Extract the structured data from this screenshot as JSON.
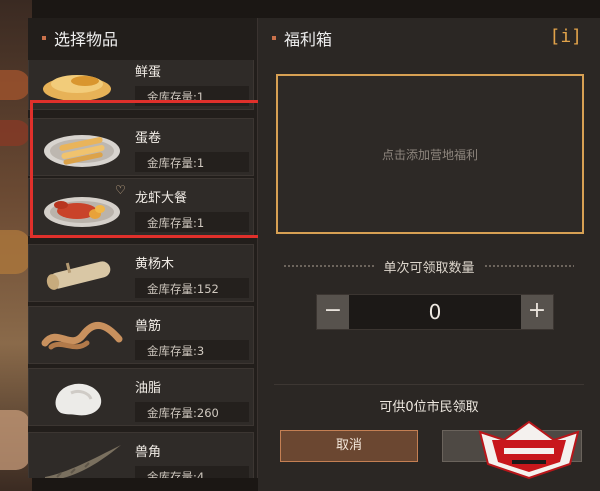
{
  "left_panel": {
    "title": "选择物品",
    "items": [
      {
        "name": "鲜蛋",
        "stock": "金库存量:1",
        "icon": "egg-dish-icon"
      },
      {
        "name": "蛋卷",
        "stock": "金库存量:1",
        "icon": "egg-roll-icon"
      },
      {
        "name": "龙虾大餐",
        "stock": "金库存量:1",
        "icon": "lobster-meal-icon",
        "favorite": "♡"
      },
      {
        "name": "黄杨木",
        "stock": "金库存量:152",
        "icon": "wood-log-icon"
      },
      {
        "name": "兽筋",
        "stock": "金库存量:3",
        "icon": "tendon-icon"
      },
      {
        "name": "油脂",
        "stock": "金库存量:260",
        "icon": "fat-icon"
      },
      {
        "name": "兽角",
        "stock": "金库存量:4",
        "icon": "horn-icon"
      }
    ]
  },
  "right_panel": {
    "title": "福利箱",
    "info_glyph": "[i]",
    "dropzone_hint": "点击添加营地福利",
    "quantity_label": "单次可领取数量",
    "quantity": {
      "minus": "−",
      "value": "0",
      "plus": "+"
    },
    "citizens_text": "可供0位市民领取",
    "cancel_label": "取消",
    "confirm_label": ""
  },
  "colors": {
    "accent_gold": "#d7a053",
    "highlight_red": "#e0302b",
    "cancel_brown": "#6b4731"
  }
}
